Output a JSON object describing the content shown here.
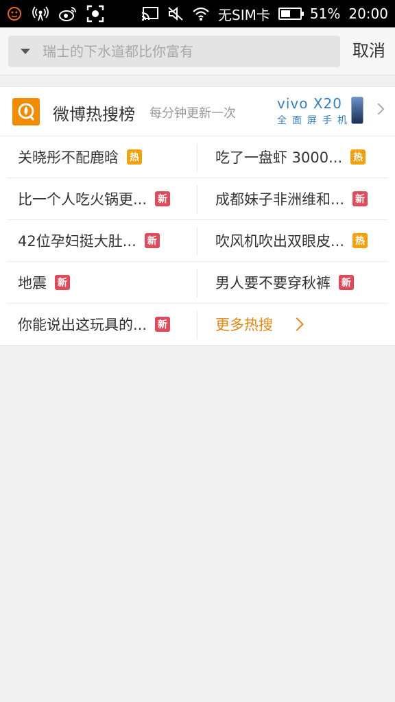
{
  "status_bar": {
    "carrier": "无SIM卡",
    "battery_percent": "51%",
    "battery_level": 0.51,
    "time": "20:00"
  },
  "search": {
    "placeholder": "瑞士的下水道都比你富有",
    "value": "",
    "cancel_label": "取消"
  },
  "hot_list": {
    "title": "微博热搜榜",
    "subtitle": "每分钟更新一次",
    "ad": {
      "brand": "vivo X20",
      "tagline": "全面屏手机"
    },
    "rows": [
      {
        "left": {
          "text": "关晓彤不配鹿晗",
          "badge": "热",
          "badge_type": "hot"
        },
        "right": {
          "text": "吃了一盘虾 3000...",
          "badge": "热",
          "badge_type": "hot"
        }
      },
      {
        "left": {
          "text": "比一个人吃火锅更...",
          "badge": "新",
          "badge_type": "new"
        },
        "right": {
          "text": "成都妹子非洲维和...",
          "badge": "新",
          "badge_type": "new"
        }
      },
      {
        "left": {
          "text": "42位孕妇挺大肚...",
          "badge": "新",
          "badge_type": "new"
        },
        "right": {
          "text": "吹风机吹出双眼皮...",
          "badge": "热",
          "badge_type": "hot"
        }
      },
      {
        "left": {
          "text": "地震",
          "badge": "新",
          "badge_type": "new"
        },
        "right": {
          "text": "男人要不要穿秋裤",
          "badge": "新",
          "badge_type": "new"
        }
      },
      {
        "left": {
          "text": "你能说出这玩具的...",
          "badge": "新",
          "badge_type": "new"
        },
        "right": {
          "more": "更多热搜"
        }
      }
    ]
  },
  "colors": {
    "hot": "#f2a10b",
    "new": "#e04a5a",
    "accent": "#e8850c",
    "logo": "#f18b00"
  }
}
